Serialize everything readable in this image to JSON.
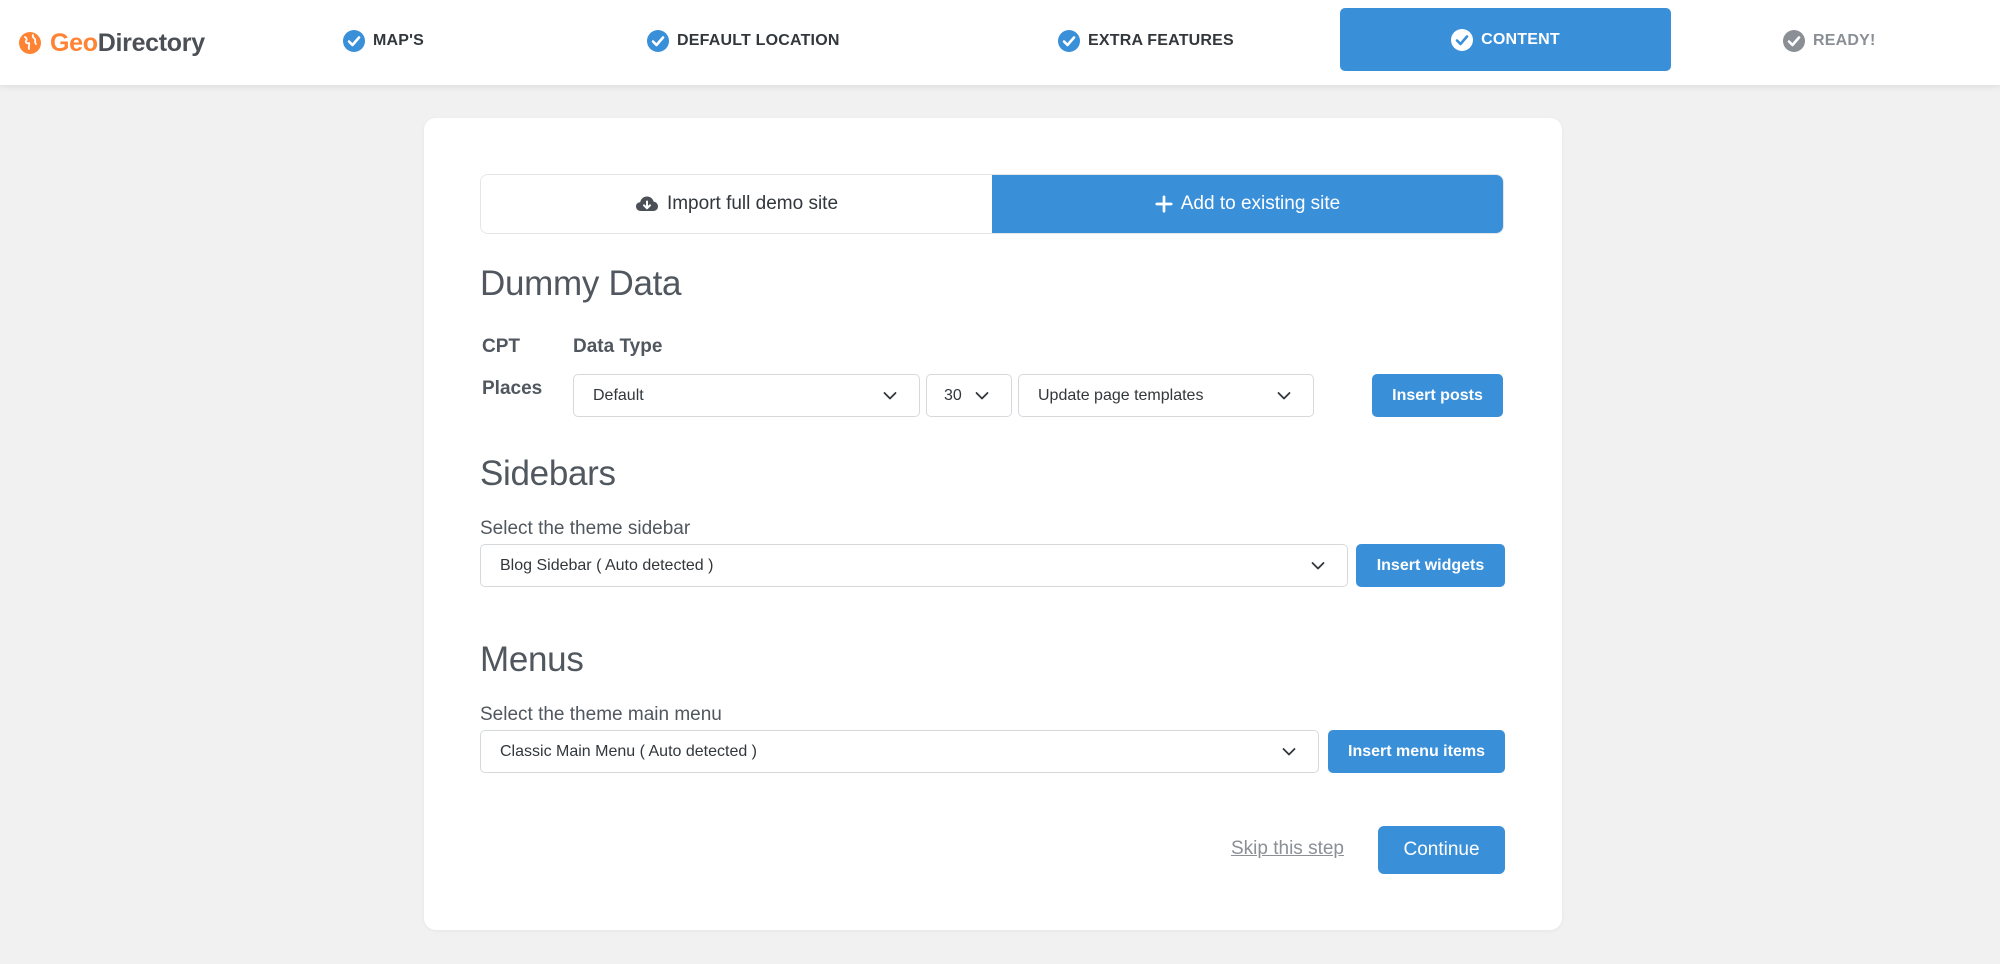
{
  "brand": {
    "geo": "Geo",
    "directory": "Directory",
    "accent": "#ff8333"
  },
  "steps": [
    {
      "label": "MAP'S",
      "state": "done"
    },
    {
      "label": "DEFAULT LOCATION",
      "state": "done"
    },
    {
      "label": "EXTRA FEATURES",
      "state": "done"
    },
    {
      "label": "CONTENT",
      "state": "active"
    },
    {
      "label": "READY!",
      "state": "pending"
    }
  ],
  "tabs": {
    "import_label": "Import full demo site",
    "add_label": "Add to existing site"
  },
  "dummy_data": {
    "heading": "Dummy Data",
    "col_cpt": "CPT",
    "col_type": "Data Type",
    "row_label": "Places",
    "type_value": "Default",
    "count_value": "30",
    "template_value": "Update page templates",
    "button": "Insert posts"
  },
  "sidebars": {
    "heading": "Sidebars",
    "label": "Select the theme sidebar",
    "value": "Blog Sidebar ( Auto detected )",
    "button": "Insert widgets"
  },
  "menus": {
    "heading": "Menus",
    "label": "Select the theme main menu",
    "value": "Classic Main Menu ( Auto detected )",
    "button": "Insert menu items"
  },
  "footer": {
    "skip": "Skip this step",
    "continue": "Continue"
  },
  "colors": {
    "primary": "#3a8fd9",
    "background": "#f1f1f1"
  }
}
